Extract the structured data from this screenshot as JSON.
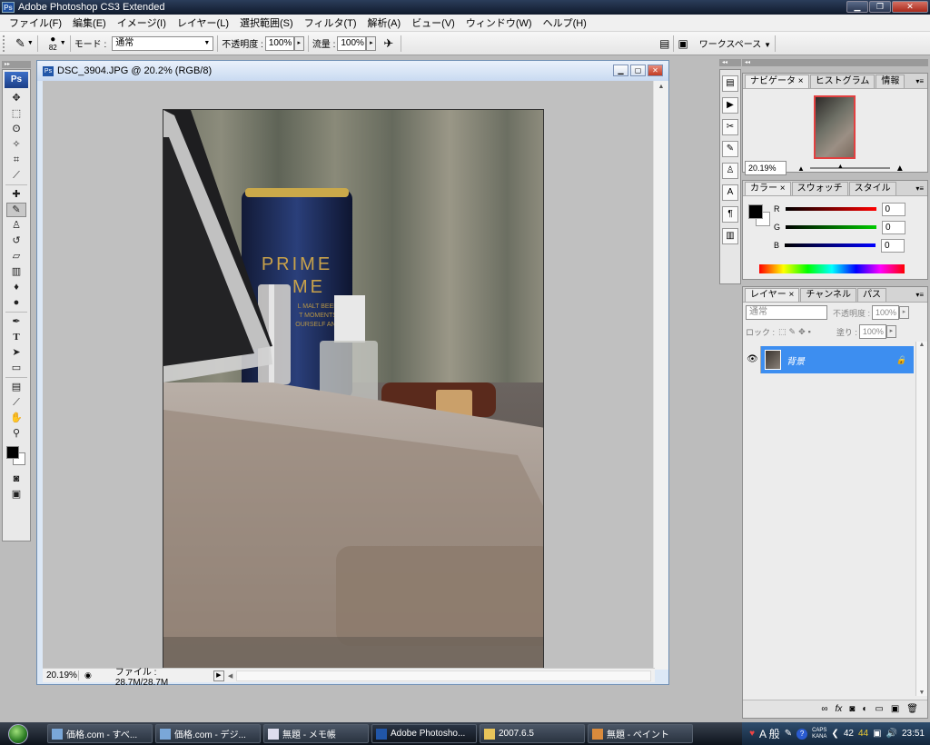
{
  "app": {
    "title": "Adobe Photoshop CS3 Extended"
  },
  "menu": [
    "ファイル(F)",
    "編集(E)",
    "イメージ(I)",
    "レイヤー(L)",
    "選択範囲(S)",
    "フィルタ(T)",
    "解析(A)",
    "ビュー(V)",
    "ウィンドウ(W)",
    "ヘルプ(H)"
  ],
  "options": {
    "brush_size": "82",
    "mode_label": "モード :",
    "mode_value": "通常",
    "opacity_label": "不透明度 :",
    "opacity_value": "100%",
    "flow_label": "流量 :",
    "flow_value": "100%",
    "workspace_label": "ワークスペース"
  },
  "document": {
    "title": "DSC_3904.JPG @ 20.2% (RGB/8)",
    "zoom": "20.19%",
    "file_info": "ファイル : 28.7M/28.7M"
  },
  "photo": {
    "can_line1": "PRIME",
    "can_line2": "ME",
    "can_small1": "L MALT BEER",
    "can_small2": "T MOMENTS",
    "can_small3": "OURSELF AND"
  },
  "navigator": {
    "tabs": [
      "ナビゲータ",
      "ヒストグラム",
      "情報"
    ],
    "zoom": "20.19%"
  },
  "color": {
    "tabs": [
      "カラー",
      "スウォッチ",
      "スタイル"
    ],
    "r_label": "R",
    "g_label": "G",
    "b_label": "B",
    "r": "0",
    "g": "0",
    "b": "0"
  },
  "layers": {
    "tabs": [
      "レイヤー",
      "チャンネル",
      "パス"
    ],
    "blend": "通常",
    "opacity_label": "不透明度 :",
    "opacity_value": "100%",
    "lock_label": "ロック :",
    "fill_label": "塗り :",
    "fill_value": "100%",
    "layer_name": "背景"
  },
  "taskbar": {
    "items": [
      "価格.com - すべ...",
      "価格.com - デジ...",
      "無題 - メモ帳",
      "Adobe Photosho...",
      "2007.6.5",
      "無題 - ペイント"
    ],
    "ime": "A 般",
    "caps": "CAPS",
    "kana": "KANA",
    "temp1": "42",
    "temp2": "44",
    "clock": "23:51"
  }
}
